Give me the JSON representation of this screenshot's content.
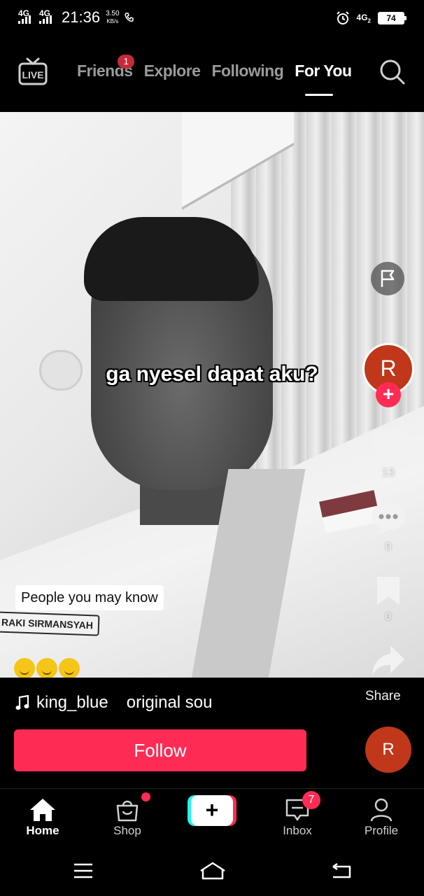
{
  "status_bar": {
    "network1": "4G",
    "network2": "4G",
    "time": "21:36",
    "net_speed_value": "3.50",
    "net_speed_unit": "KB/s",
    "network3": "4G",
    "network3_sub": "2",
    "battery": "74"
  },
  "top_nav": {
    "live_label": "LIVE",
    "tabs": [
      {
        "label": "Friends",
        "badge": "1"
      },
      {
        "label": "Explore"
      },
      {
        "label": "Following"
      },
      {
        "label": "For You",
        "active": true
      }
    ]
  },
  "video": {
    "caption": "ga nyesel dapat aku?",
    "name_tag_text": "RAKI SIRMANSYAH"
  },
  "right_rail": {
    "avatar_initial": "R",
    "likes": "13",
    "comments": "0",
    "saves": "0",
    "share_label": "Share"
  },
  "overlay": {
    "people_you_may_know": "People you may know",
    "emoji_count": 3
  },
  "info": {
    "username": "king_blue",
    "sound": "original sou",
    "follow_label": "Follow",
    "disc_initial": "R"
  },
  "tab_bar": {
    "home": "Home",
    "shop": "Shop",
    "create": "+",
    "inbox": "Inbox",
    "inbox_badge": "7",
    "profile": "Profile"
  },
  "colors": {
    "accent": "#fe2c55",
    "avatar_bg": "#c0371a",
    "cyan": "#25f4ee"
  }
}
